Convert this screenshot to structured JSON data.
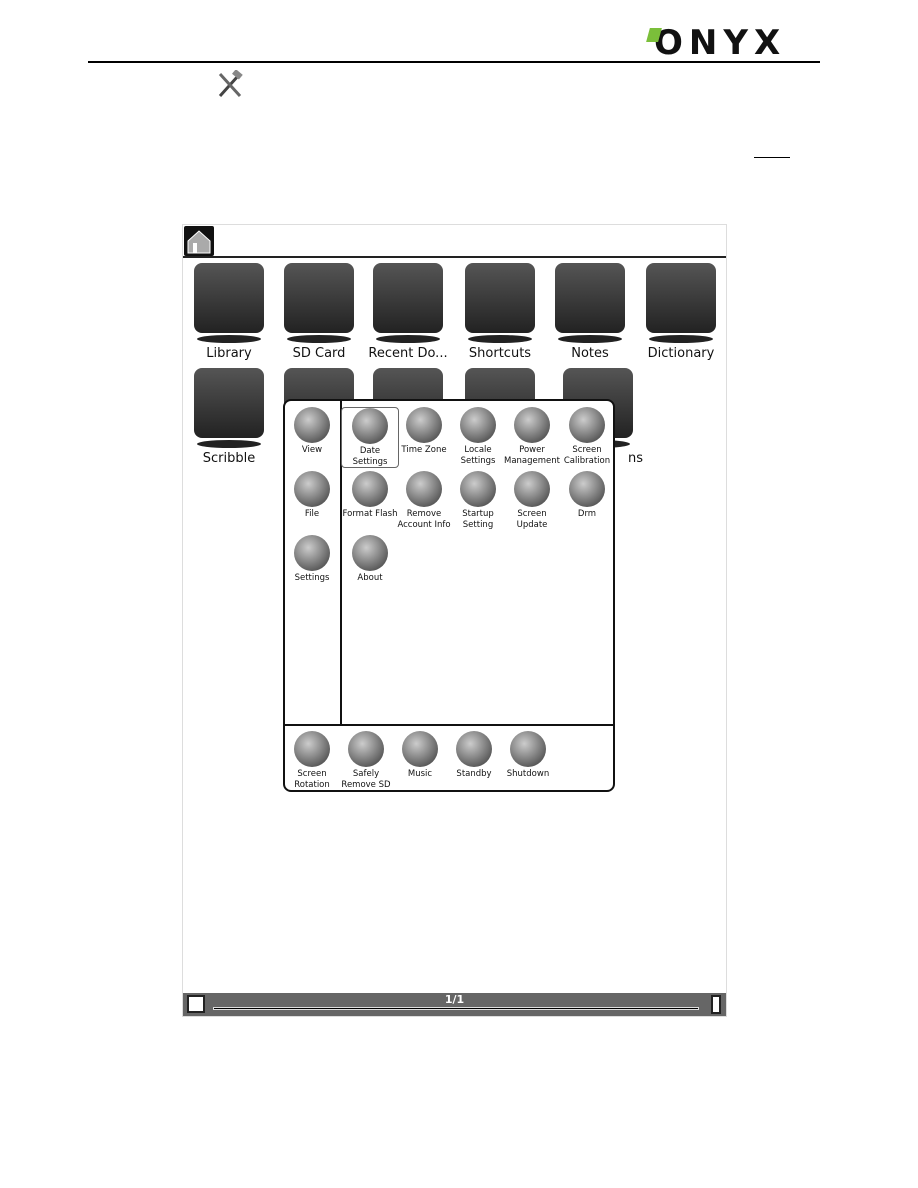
{
  "header": {
    "logo": "ONYX",
    "logo_accent": "#7bbf3a"
  },
  "doc": {
    "tools_icon": "tools-icon"
  },
  "device": {
    "top_bar": {
      "home_icon": "home-icon"
    },
    "grid": [
      {
        "label": "Library",
        "icon": "books-icon"
      },
      {
        "label": "SD Card",
        "icon": "sd-card-icon"
      },
      {
        "label": "Recent Do...",
        "icon": "recent-documents-icon"
      },
      {
        "label": "Shortcuts",
        "icon": "shortcut-icon"
      },
      {
        "label": "Notes",
        "icon": "notes-icon"
      },
      {
        "label": "Dictionary",
        "icon": "dictionary-icon"
      },
      {
        "label": "Scribble",
        "icon": "scribble-icon"
      },
      {
        "label": "",
        "icon": "globe-icon"
      },
      {
        "label": "",
        "icon": "gamepad-icon"
      },
      {
        "label": "",
        "icon": "settings-gear-icon"
      },
      {
        "label": "ns",
        "icon": "applications-icon"
      }
    ],
    "menu": {
      "categories": [
        {
          "label": "View"
        },
        {
          "label": "File"
        },
        {
          "label": "Settings"
        }
      ],
      "items": [
        {
          "label": "Date\nSettings",
          "selected": true
        },
        {
          "label": "Time Zone"
        },
        {
          "label": "Locale\nSettings"
        },
        {
          "label": "Power\nManagement"
        },
        {
          "label": "Screen\nCalibration"
        },
        {
          "label": "Format Flash"
        },
        {
          "label": "Remove\nAccount Info"
        },
        {
          "label": "Startup\nSetting"
        },
        {
          "label": "Screen\nUpdate"
        },
        {
          "label": "Drm"
        },
        {
          "label": "About"
        }
      ],
      "bottom": [
        {
          "label": "Screen\nRotation"
        },
        {
          "label": "Safely\nRemove SD"
        },
        {
          "label": "Music"
        },
        {
          "label": "Standby"
        },
        {
          "label": "Shutdown"
        }
      ]
    },
    "status": {
      "page": "1/1",
      "progress": 1.0
    }
  }
}
